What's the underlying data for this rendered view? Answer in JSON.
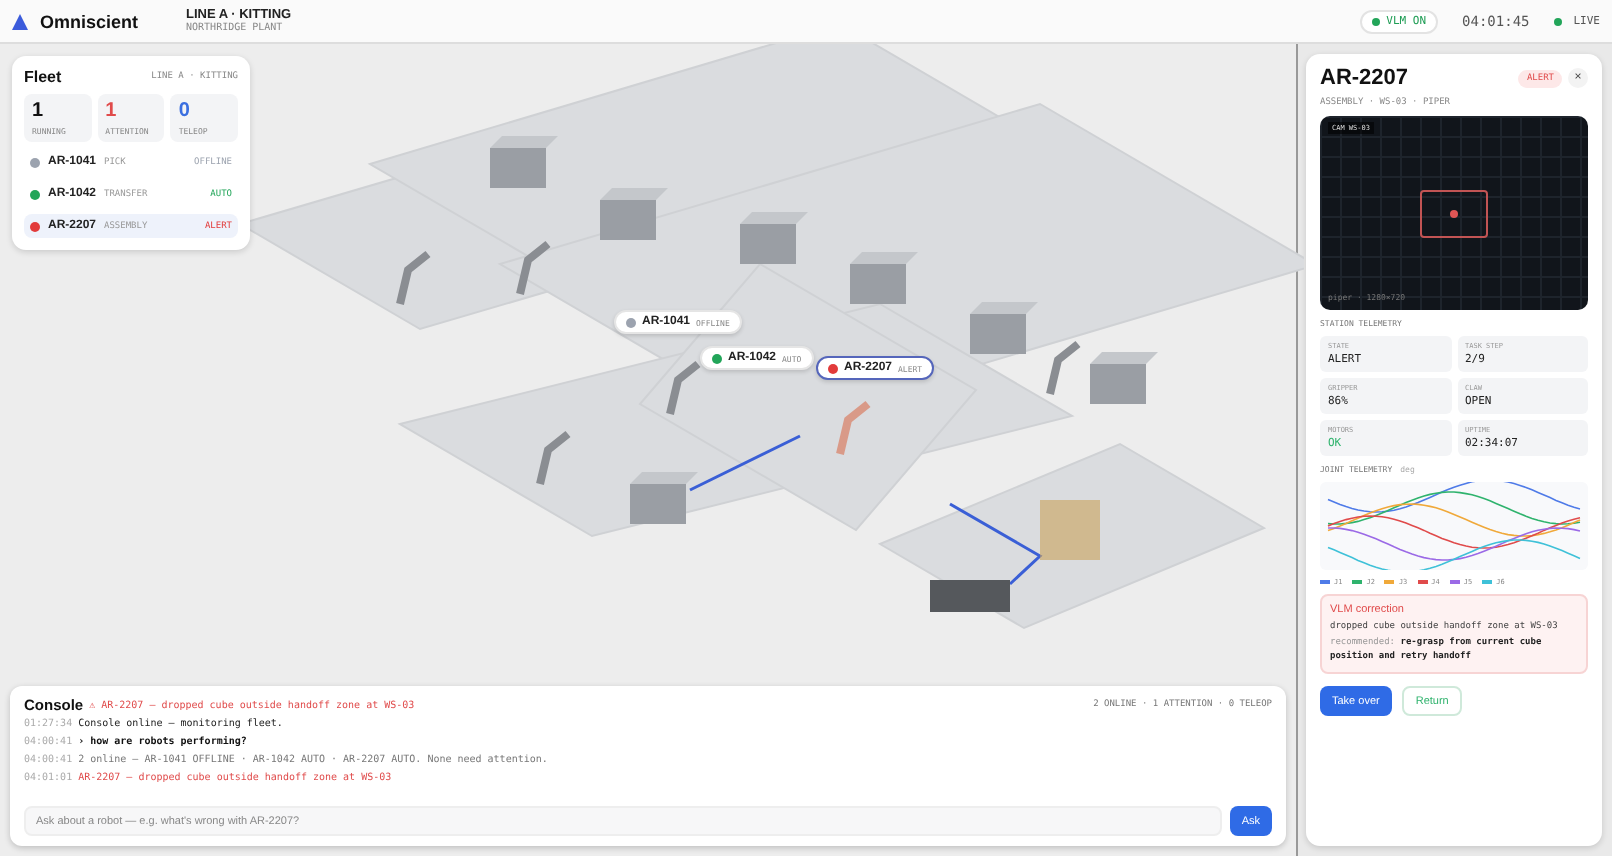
{
  "header": {
    "brand": "Omniscient",
    "line": "LINE A · KITTING",
    "plant": "NORTHRIDGE PLANT",
    "vlm": "VLM ON",
    "clock": "04:01:45",
    "live": "LIVE"
  },
  "fleet": {
    "title": "Fleet",
    "subtitle": "LINE A · KITTING",
    "stats": [
      {
        "value": "1",
        "label": "RUNNING",
        "kind": "running"
      },
      {
        "value": "1",
        "label": "ATTENTION",
        "kind": "attention"
      },
      {
        "value": "0",
        "label": "TELEOP",
        "kind": "teleop"
      }
    ],
    "robots": [
      {
        "id": "AR-1041",
        "role": "PICK",
        "status": "OFFLINE",
        "color": "#9ca3af",
        "selected": false
      },
      {
        "id": "AR-1042",
        "role": "TRANSFER",
        "status": "AUTO",
        "color": "#22a559",
        "selected": false
      },
      {
        "id": "AR-2207",
        "role": "ASSEMBLY",
        "status": "ALERT",
        "color": "#e23b3b",
        "selected": true
      }
    ]
  },
  "tags": [
    {
      "id": "AR-1041",
      "status": "OFFLINE",
      "color": "#9ca3af",
      "selected": false
    },
    {
      "id": "AR-1042",
      "status": "AUTO",
      "color": "#22a559",
      "selected": false
    },
    {
      "id": "AR-2207",
      "status": "ALERT",
      "color": "#e23b3b",
      "selected": true
    }
  ],
  "panel": {
    "title": "AR-2207",
    "badge": "ALERT",
    "subtitle": "ASSEMBLY · WS-03 · PIPER",
    "close": "×",
    "camera_label": "CAM WS-03",
    "camera_caption": "piper · 1280×720",
    "telemetry_heading": "STATION TELEMETRY",
    "cells": [
      {
        "label": "STATE",
        "value": "ALERT",
        "kind": "plain"
      },
      {
        "label": "TASK STEP",
        "value": "2/9",
        "kind": "plain"
      },
      {
        "label": "GRIPPER",
        "value": "86%",
        "kind": "plain"
      },
      {
        "label": "CLAW",
        "value": "OPEN",
        "kind": "plain"
      },
      {
        "label": "MOTORS",
        "value": "OK",
        "kind": "good"
      },
      {
        "label": "UPTIME",
        "value": "02:34:07",
        "kind": "plain"
      }
    ],
    "joint_heading": "JOINT TELEMETRY",
    "joint_unit": "deg",
    "joints": [
      {
        "label": "J1",
        "color": "#4f7be8"
      },
      {
        "label": "J2",
        "color": "#2fb36d"
      },
      {
        "label": "J3",
        "color": "#f0a93a"
      },
      {
        "label": "J4",
        "color": "#e04b4b"
      },
      {
        "label": "J5",
        "color": "#9b6ae6"
      },
      {
        "label": "J6",
        "color": "#3fc1d8"
      }
    ],
    "correction": {
      "title": "VLM correction",
      "message": "dropped cube outside handoff zone at WS-03",
      "recommended_label": "recommended:",
      "recommended": "re-grasp from current cube position and retry handoff"
    },
    "buttons": [
      {
        "label": "Take over",
        "kind": "primary"
      },
      {
        "label": "Return",
        "kind": "secondary"
      }
    ]
  },
  "console": {
    "title": "Console",
    "alert": "⚠ AR-2207 — dropped cube outside handoff zone at WS-03",
    "counts": "2 ONLINE · 1 ATTENTION · 0 TELEOP",
    "lines": [
      {
        "time": "01:27:34",
        "text": "Console online — monitoring fleet.",
        "kind": "info"
      },
      {
        "time": "04:00:41",
        "text": "› how are robots performing?",
        "kind": "query"
      },
      {
        "time": "04:00:41",
        "text": "2 online — AR-1041 OFFLINE · AR-1042 AUTO · AR-2207 AUTO. None need attention.",
        "kind": "reply"
      },
      {
        "time": "04:01:01",
        "text": "AR-2207 — dropped cube outside handoff zone at WS-03",
        "kind": "alert"
      }
    ],
    "placeholder": "Ask about a robot — e.g. what's wrong with AR-2207?",
    "ask": "Ask"
  }
}
